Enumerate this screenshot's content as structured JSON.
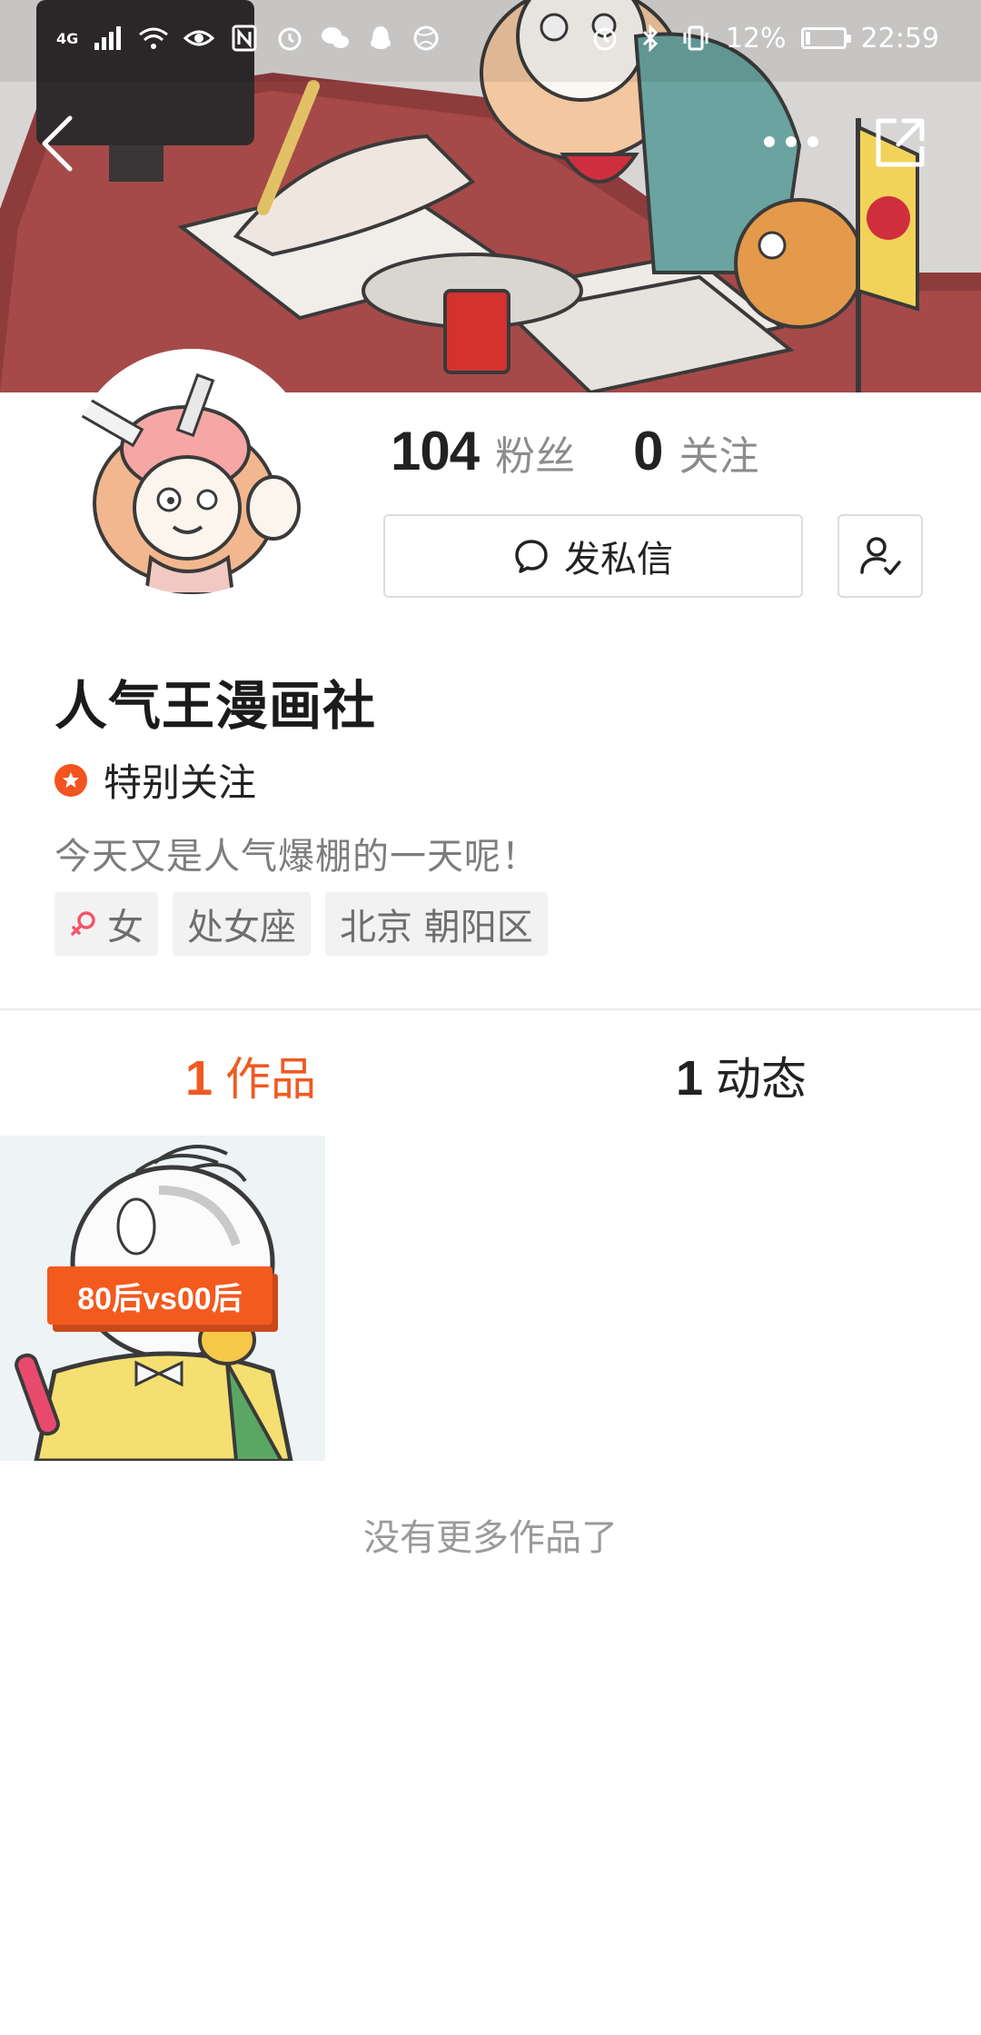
{
  "status_bar": {
    "network": "4G",
    "battery": "12%",
    "battery_level": 0.12,
    "time": "22:59"
  },
  "nav": {
    "back_icon": "chevron-left-icon",
    "more_icon": "more-dots-icon",
    "share_icon": "share-icon"
  },
  "stats": {
    "followers_count": "104",
    "followers_label": "粉丝",
    "following_count": "0",
    "following_label": "关注"
  },
  "actions": {
    "message_label": "发私信",
    "message_icon": "chat-bubble-icon",
    "follow_icon": "user-check-icon"
  },
  "profile": {
    "name": "人气王漫画社",
    "special_follow": "特别关注",
    "bio": "今天又是人气爆棚的一天呢！",
    "tags": [
      "女",
      "处女座",
      "北京 朝阳区"
    ]
  },
  "tabs": [
    {
      "count": "1",
      "label": "作品",
      "active": true
    },
    {
      "count": "1",
      "label": "动态",
      "active": false
    }
  ],
  "works": [
    {
      "badge": "80后vs00后"
    }
  ],
  "footer": {
    "no_more": "没有更多作品了"
  },
  "colors": {
    "accent": "#f05a22",
    "badge": "#f35a1e"
  }
}
